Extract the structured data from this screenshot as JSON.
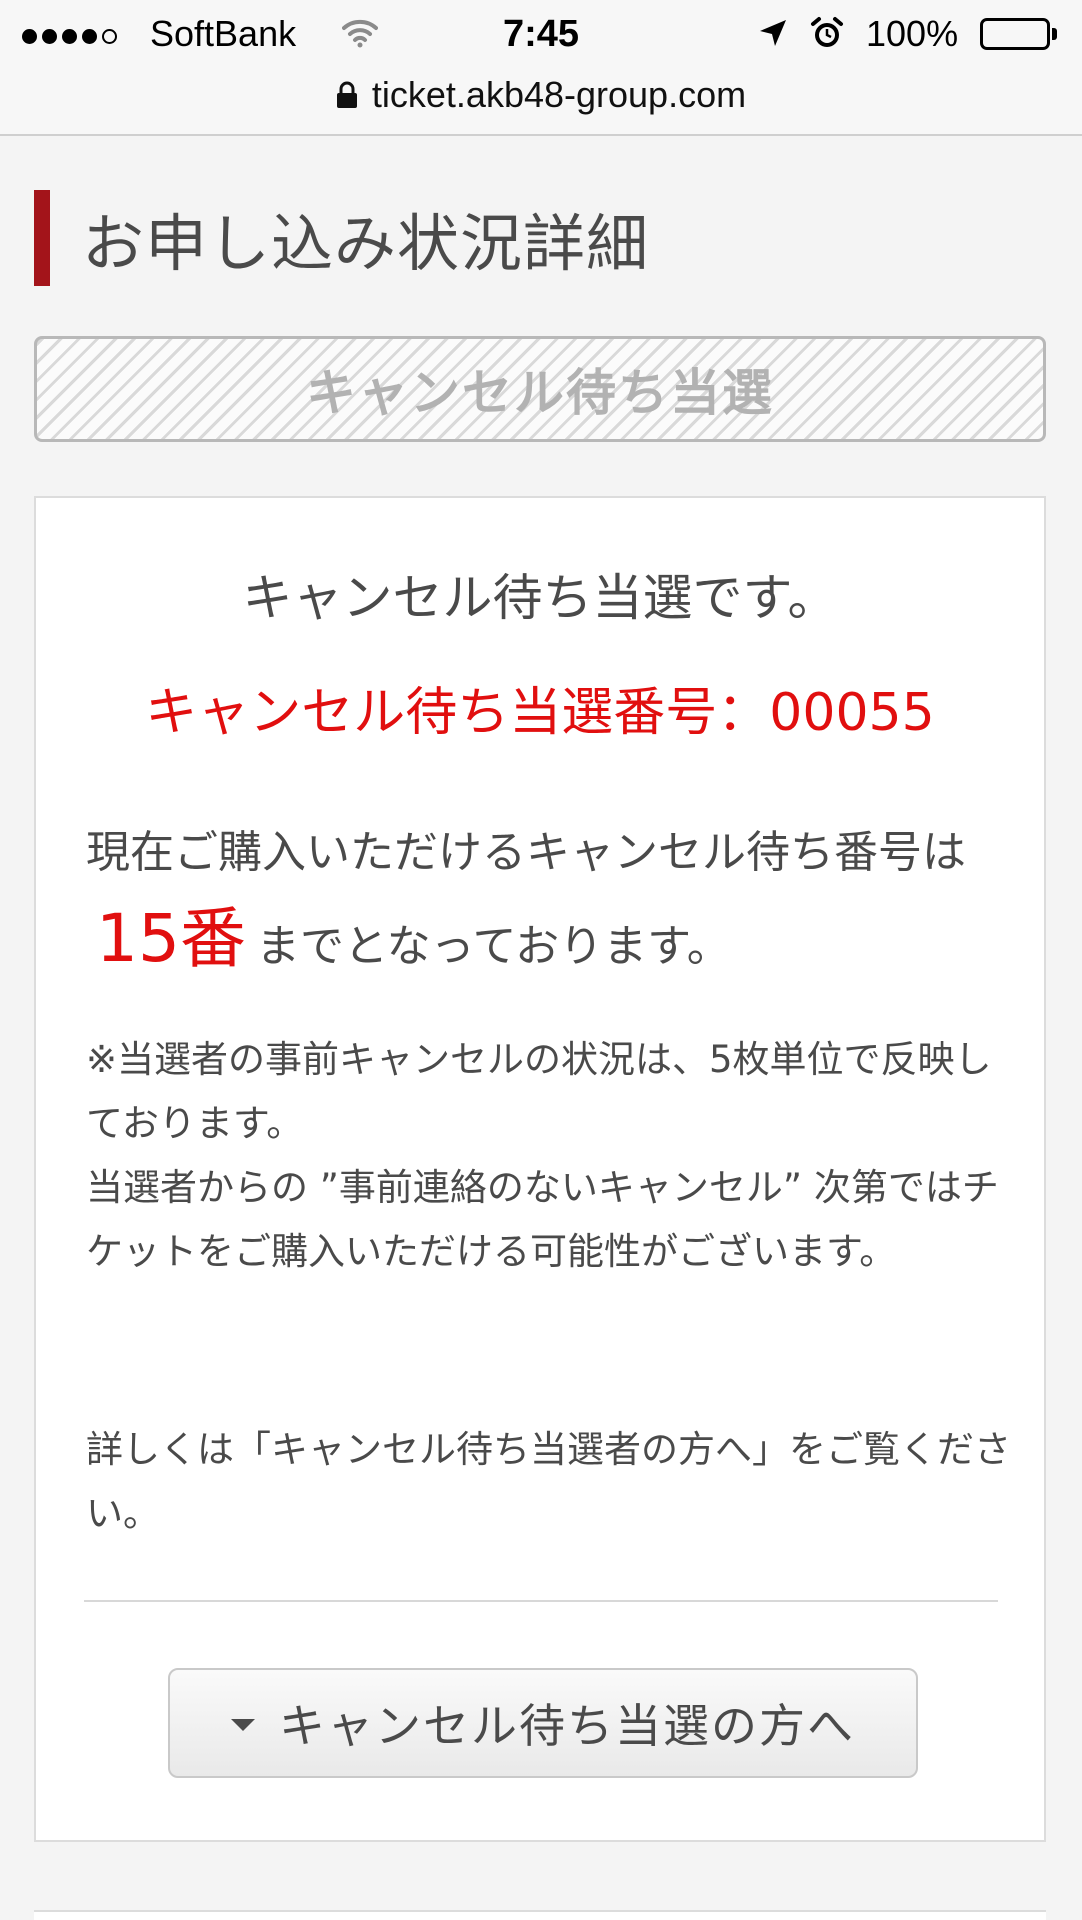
{
  "status_bar": {
    "carrier": "SoftBank",
    "time": "7:45",
    "battery_percent": "100%",
    "signal_bars_filled": 4,
    "signal_bars_total": 5
  },
  "address_bar": {
    "url": "ticket.akb48-group.com"
  },
  "page": {
    "title": "お申し込み状況詳細",
    "status_label": "キャンセル待ち当選"
  },
  "result": {
    "heading": "キャンセル待ち当選です。",
    "winning_number": "キャンセル待ち当選番号：00055",
    "availability_prefix": "現在ご購入いただけるキャンセル待ち番号は",
    "available_number": "15番",
    "availability_suffix": "までとなっております。"
  },
  "notes": {
    "line1": "※当選者の事前キャンセルの状況は、5枚単位で反映しております。",
    "line2": "当選者からの ”事前連絡のないキャンセル” 次第ではチケットをご購入いただける可能性がございます。",
    "details": "詳しくは「キャンセル待ち当選者の方へ」をご覧ください。"
  },
  "actions": {
    "guide_button_label": "キャンセル待ち当選の方へ"
  },
  "colors": {
    "accent_bar": "#a3141a",
    "highlight_red": "#e10f0f",
    "text_gray": "#4a4a4a"
  }
}
